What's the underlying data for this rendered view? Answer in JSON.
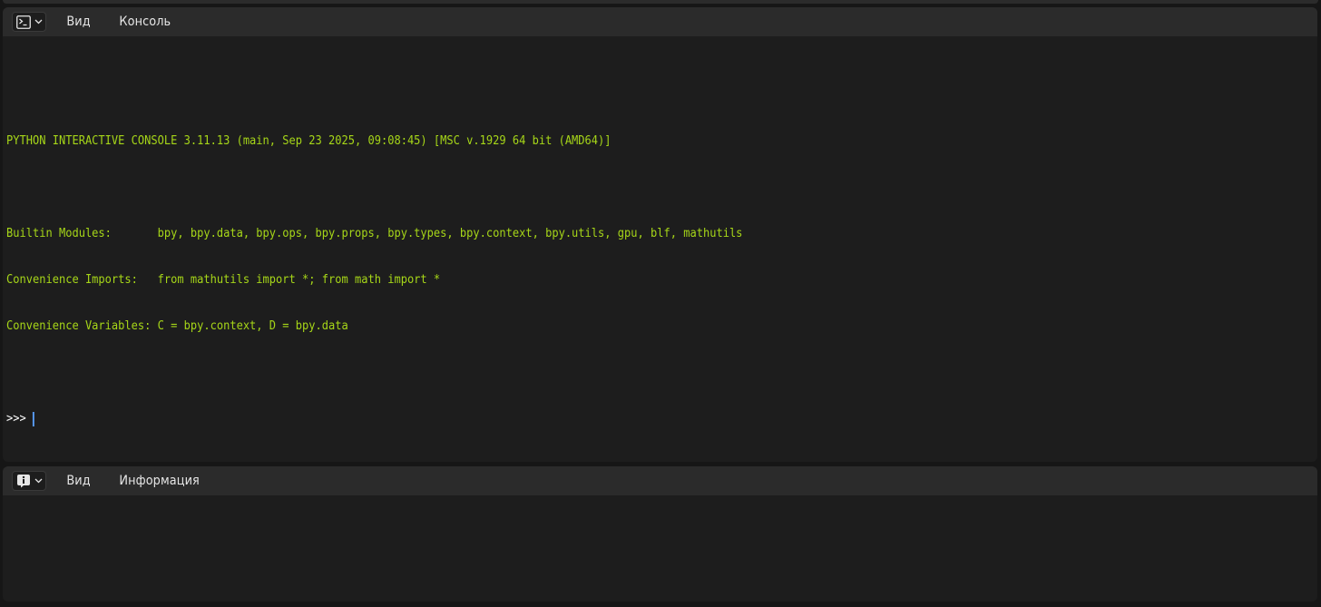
{
  "console_editor": {
    "type_icon": "terminal-icon",
    "menus": [
      "Вид",
      "Консоль"
    ],
    "lines": [
      "PYTHON INTERACTIVE CONSOLE 3.11.13 (main, Sep 23 2025, 09:08:45) [MSC v.1929 64 bit (AMD64)]",
      "",
      "Builtin Modules:       bpy, bpy.data, bpy.ops, bpy.props, bpy.types, bpy.context, bpy.utils, gpu, blf, mathutils",
      "Convenience Imports:   from mathutils import *; from math import *",
      "Convenience Variables: C = bpy.context, D = bpy.data",
      ""
    ],
    "prompt": ">>>"
  },
  "info_editor": {
    "type_icon": "info-icon",
    "menus": [
      "Вид",
      "Информация"
    ]
  },
  "colors": {
    "console_text": "#a6d618",
    "prompt_text": "#ffffff",
    "cursor": "#5aa0ff",
    "header_bg": "#2b2b2b",
    "editor_bg": "#1d1d1d"
  }
}
